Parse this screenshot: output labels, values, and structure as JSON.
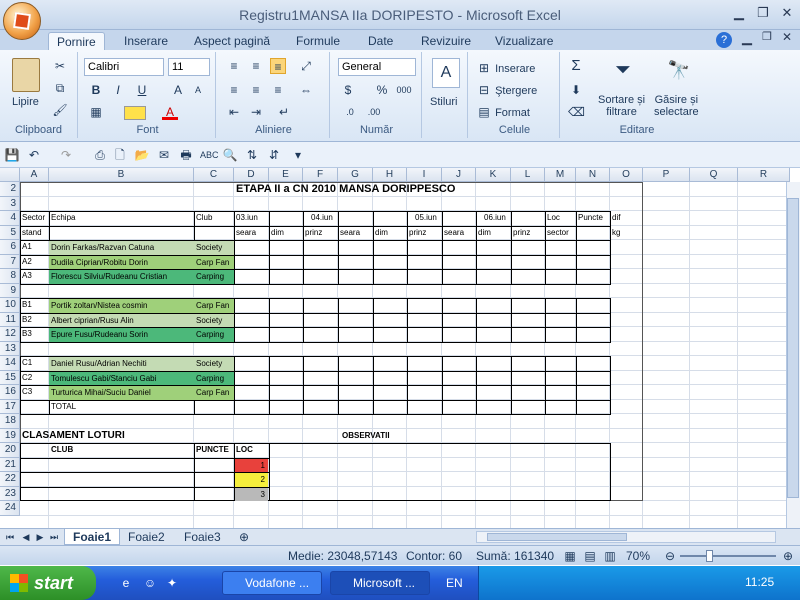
{
  "window": {
    "title": "Registru1MANSA IIa DORIPESTO - Microsoft Excel"
  },
  "tabs": [
    "Pornire",
    "Inserare",
    "Aspect pagină",
    "Formule",
    "Date",
    "Revizuire",
    "Vizualizare"
  ],
  "ribbon": {
    "clipboard": {
      "paste": "Lipire",
      "label": "Clipboard"
    },
    "font": {
      "name": "Calibri",
      "size": "11",
      "label": "Font"
    },
    "align": {
      "label": "Aliniere"
    },
    "number": {
      "format": "General",
      "label": "Număr"
    },
    "styles": {
      "label": "Stiluri"
    },
    "cells": {
      "insert": "Inserare",
      "delete": "Ştergere",
      "format": "Format",
      "label": "Celule"
    },
    "edit": {
      "sort": "Sortare și\nfiltrare",
      "find": "Găsire și\nselectare",
      "label": "Editare"
    }
  },
  "columns": [
    "A",
    "B",
    "C",
    "D",
    "E",
    "F",
    "G",
    "H",
    "I",
    "J",
    "K",
    "L",
    "M",
    "N",
    "O",
    "P",
    "Q",
    "R"
  ],
  "rows": [
    "2",
    "3",
    "4",
    "5",
    "6",
    "7",
    "8",
    "9",
    "10",
    "11",
    "12",
    "13",
    "14",
    "15",
    "16",
    "17",
    "18",
    "19",
    "20",
    "21",
    "22",
    "23",
    "24"
  ],
  "sheet": {
    "title": "ETAPA II a CN 2010 MANSA DORIPPESCO",
    "hdr4": {
      "a": "Sector",
      "b": "Echipa",
      "c": "Club",
      "d": "03.iun",
      "f": "04.iun",
      "i": "05.iun",
      "k": "06.iun",
      "m": "Loc",
      "n": "Puncte",
      "o": "dif"
    },
    "hdr5": {
      "a": "stand",
      "d": "seara",
      "e": "dim",
      "f": "prinz",
      "g": "seara",
      "h": "dim",
      "i": "prinz",
      "j": "seara",
      "k": "dim",
      "l": "prinz",
      "m": "sector",
      "o": "kg"
    },
    "teams": [
      {
        "row": 6,
        "sector": "A1",
        "team": "Dorin Farkas/Razvan Catuna",
        "club": "Society",
        "color": "#c4dbb4"
      },
      {
        "row": 7,
        "sector": "A2",
        "team": "Dudila Ciprian/Robitu Dorin",
        "club": "Carp Fan",
        "color": "#9fd07a"
      },
      {
        "row": 8,
        "sector": "A3",
        "team": "Florescu Silviu/Rudeanu Cristian",
        "club": "Carping",
        "color": "#4cb87a"
      },
      {
        "row": 10,
        "sector": "B1",
        "team": "Portik zoltan/Nistea cosmin",
        "club": "Carp Fan",
        "color": "#9fd07a"
      },
      {
        "row": 11,
        "sector": "B2",
        "team": "Albert ciprian/Rusu Alin",
        "club": "Society",
        "color": "#c4dbb4"
      },
      {
        "row": 12,
        "sector": "B3",
        "team": "Epure Fusu/Rudeanu Sorin",
        "club": "Carping",
        "color": "#4cb87a"
      },
      {
        "row": 14,
        "sector": "C1",
        "team": "Daniel Rusu/Adrian Nechiti",
        "club": "Society",
        "color": "#c4dbb4"
      },
      {
        "row": 15,
        "sector": "C2",
        "team": "Tomulescu Gabi/Stanciu Gabi",
        "club": "Carping",
        "color": "#4cb87a"
      },
      {
        "row": 16,
        "sector": "C3",
        "team": "Turturica Mihai/Suciu Daniel",
        "club": "Carp Fan",
        "color": "#9fd07a"
      }
    ],
    "total": "TOTAL",
    "clasament": "CLASAMENT LOTURI",
    "observatii": "OBSERVATII",
    "club_hdr": "CLUB",
    "puncte_hdr": "PUNCTE",
    "loc_hdr": "LOC",
    "loc": [
      {
        "v": "1",
        "color": "#e8413c"
      },
      {
        "v": "2",
        "color": "#f5ee3c"
      },
      {
        "v": "3",
        "color": "#b9b9b9"
      }
    ]
  },
  "sheet_tabs": [
    "Foaie1",
    "Foaie2",
    "Foaie3"
  ],
  "status": {
    "medie": "Medie: 23048,57143",
    "contor": "Contor: 60",
    "suma": "Sumă: 161340",
    "zoom": "70%"
  },
  "taskbar": {
    "start": "start",
    "tasks": [
      "Vodafone ...",
      "Microsoft ..."
    ],
    "lang": "EN",
    "time": "11:25"
  }
}
